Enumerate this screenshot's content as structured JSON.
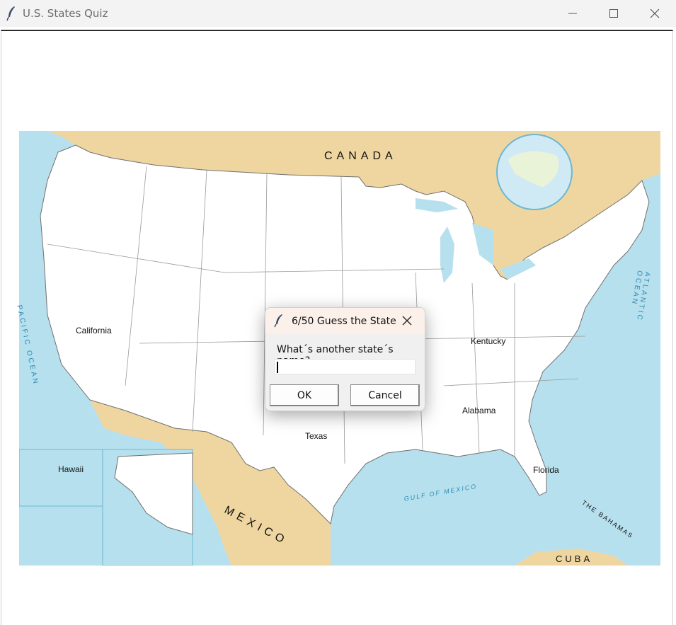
{
  "window": {
    "title": "U.S. States Quiz",
    "icon": "feather-icon",
    "controls": [
      "minimize-icon",
      "maximize-icon",
      "close-icon"
    ]
  },
  "map": {
    "state_labels": [
      "California",
      "Kentucky",
      "Alabama",
      "Texas",
      "Florida",
      "Hawaii"
    ],
    "region_labels": {
      "canada": "CANADA",
      "mexico": "MEXICO",
      "pacific": "PACIFIC OCEAN",
      "atlantic": "ATLANTIC OCEAN",
      "gulf": "GULF OF MEXICO",
      "bahamas": "THE BAHAMAS",
      "cuba": "CUBA"
    },
    "colors": {
      "water": "#b7e0ee",
      "land_foreign": "#efd6a0",
      "land_us": "#ffffff",
      "border": "#8a8a8a"
    }
  },
  "dialog": {
    "title": "6/50 Guess the State",
    "prompt": "What´s another state´s name?",
    "input_value": "",
    "ok_label": "OK",
    "cancel_label": "Cancel"
  }
}
